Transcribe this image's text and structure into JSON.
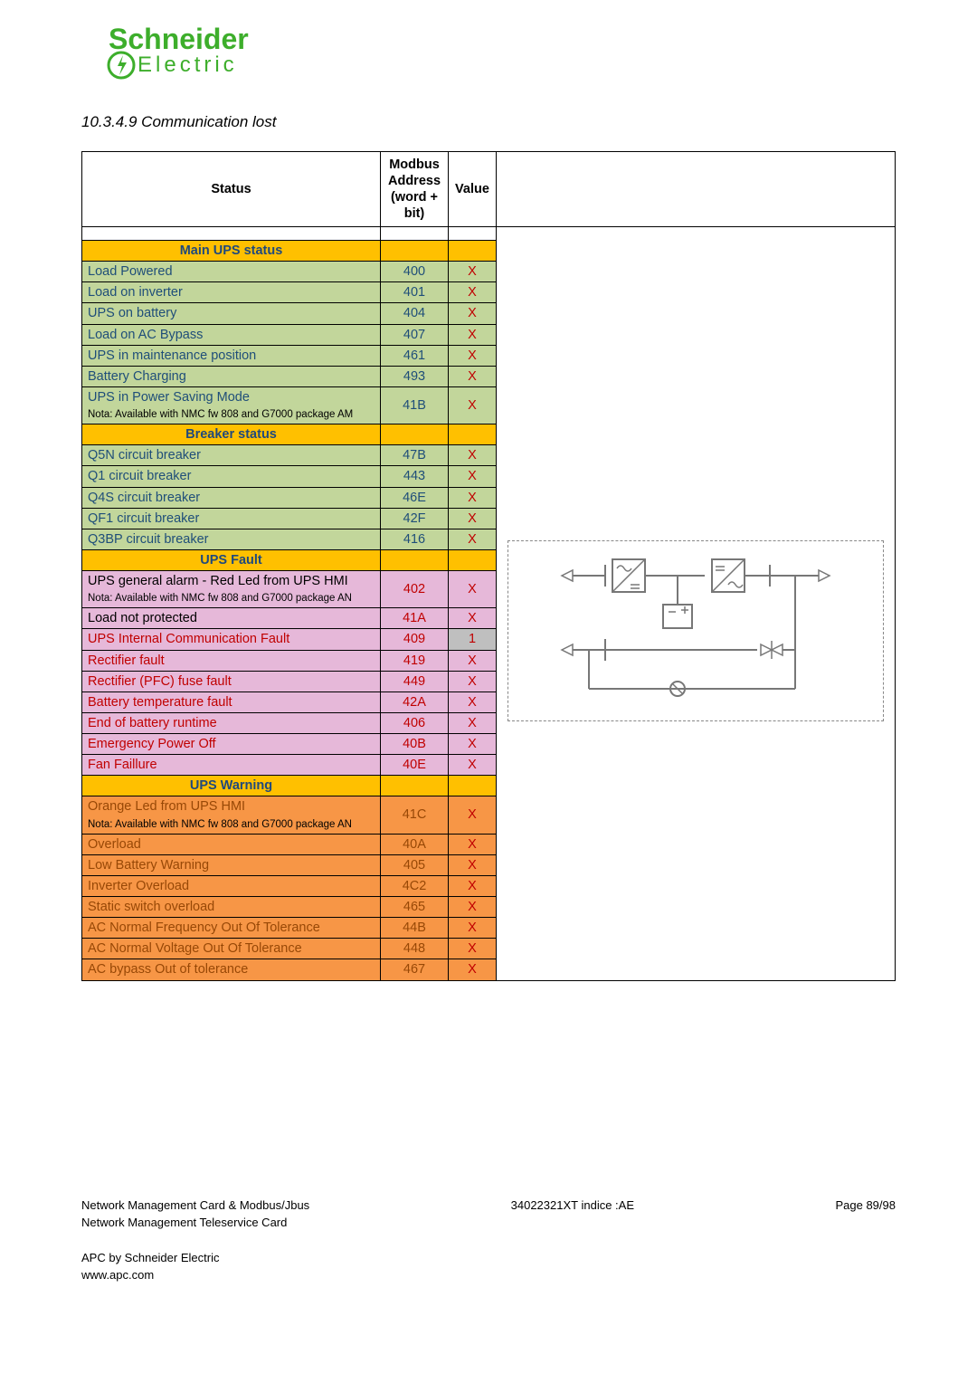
{
  "logo": {
    "top": "Schneider",
    "bottom": "Electric"
  },
  "section_title": "10.3.4.9  Communication lost",
  "headers": {
    "status": "Status",
    "address": "Modbus Address (word + bit)",
    "value": "Value"
  },
  "sections": [
    {
      "title": "Main UPS status",
      "bg": "bg-green",
      "txt": "t-blue",
      "rows": [
        {
          "status": "Load Powered",
          "addr": "400",
          "value": "X"
        },
        {
          "status": "Load on inverter",
          "addr": "401",
          "value": "X"
        },
        {
          "status": "UPS on battery",
          "addr": "404",
          "value": "X"
        },
        {
          "status": "Load on AC Bypass",
          "addr": "407",
          "value": "X"
        },
        {
          "status": "UPS in maintenance position",
          "addr": "461",
          "value": "X"
        },
        {
          "status": "Battery Charging",
          "addr": "493",
          "value": "X"
        },
        {
          "status": "UPS in Power Saving Mode",
          "nota": "Nota: Available with NMC fw 808 and G7000 package AM",
          "addr": "41B",
          "value": "X"
        }
      ]
    },
    {
      "title": "Breaker status",
      "bg": "bg-green",
      "txt": "t-blue",
      "rows": [
        {
          "status": "Q5N circuit breaker",
          "addr": "47B",
          "value": "X"
        },
        {
          "status": "Q1 circuit breaker",
          "addr": "443",
          "value": "X"
        },
        {
          "status": "Q4S circuit breaker",
          "addr": "46E",
          "value": "X"
        },
        {
          "status": "QF1 circuit breaker",
          "addr": "42F",
          "value": "X"
        },
        {
          "status": "Q3BP circuit breaker",
          "addr": "416",
          "value": "X"
        }
      ]
    },
    {
      "title": "UPS Fault",
      "bg": "bg-pink",
      "txt": "t-red",
      "rows": [
        {
          "status": "UPS general alarm - Red Led from UPS HMI",
          "status_black": true,
          "nota": "Nota: Available with NMC fw 808 and G7000 package AN",
          "addr": "402",
          "value": "X"
        },
        {
          "status": "Load not protected",
          "status_black": true,
          "addr": "41A",
          "value": "X"
        },
        {
          "status": "UPS Internal Communication Fault",
          "addr": "409",
          "value": "1",
          "value_hl": true
        },
        {
          "status": "Rectifier fault",
          "addr": "419",
          "value": "X"
        },
        {
          "status": "Rectifier (PFC) fuse fault",
          "addr": "449",
          "value": "X"
        },
        {
          "status": "Battery temperature fault",
          "addr": "42A",
          "value": "X"
        },
        {
          "status": "End of battery runtime",
          "addr": "406",
          "value": "X"
        },
        {
          "status": "Emergency Power Off",
          "addr": "40B",
          "value": "X"
        },
        {
          "status": "Fan Faillure",
          "addr": "40E",
          "value": "X"
        }
      ]
    },
    {
      "title": "UPS Warning",
      "bg": "bg-orange",
      "txt": "t-orange",
      "rows": [
        {
          "status": "Orange Led from UPS HMI",
          "nota": "Nota: Available with NMC fw 808 and G7000 package AN",
          "addr": "41C",
          "value": "X"
        },
        {
          "status": "Overload",
          "addr": "40A",
          "value": "X"
        },
        {
          "status": "Low Battery Warning",
          "addr": "405",
          "value": "X"
        },
        {
          "status": "Inverter Overload",
          "addr": "4C2",
          "value": "X"
        },
        {
          "status": "Static switch overload",
          "addr": "465",
          "value": "X"
        },
        {
          "status": "AC Normal Frequency Out Of Tolerance",
          "addr": "44B",
          "value": "X"
        },
        {
          "status": "AC Normal Voltage Out Of Tolerance",
          "addr": "448",
          "value": "X"
        },
        {
          "status": "AC bypass Out of tolerance",
          "addr": "467",
          "value": "X"
        }
      ]
    }
  ],
  "footer": {
    "left1": "Network Management Card & Modbus/Jbus",
    "left2": "Network Management Teleservice Card",
    "mid": "34022321XT indice :AE",
    "page": "Page 89/98",
    "company": "APC by Schneider Electric",
    "url": "www.apc.com"
  }
}
